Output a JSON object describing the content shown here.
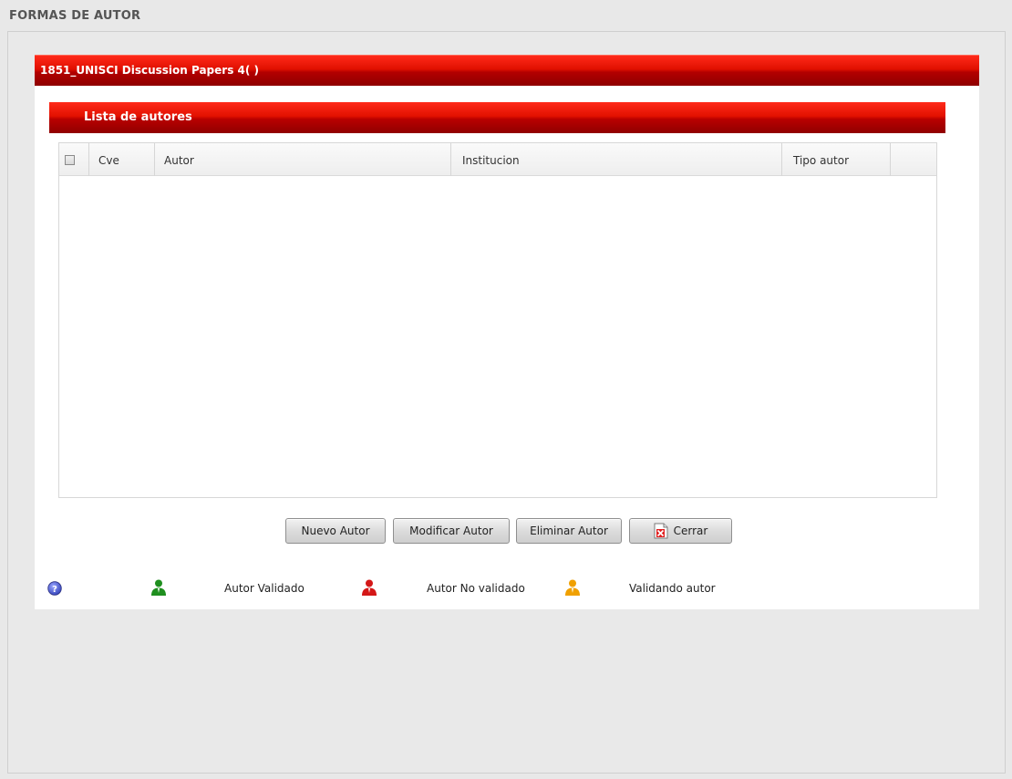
{
  "page": {
    "title": "FORMAS DE AUTOR"
  },
  "panel": {
    "header": "1851_UNISCI Discussion Papers 4( )",
    "sub_header": "Lista de autores"
  },
  "grid": {
    "columns": [
      "Cve",
      "Autor",
      "Institucion",
      "Tipo autor"
    ],
    "rows": []
  },
  "buttons": {
    "new_author": "Nuevo Autor",
    "modify_author": "Modificar Autor",
    "delete_author": "Eliminar Autor",
    "close": "Cerrar"
  },
  "legend": {
    "help_icon": "help-icon",
    "validated": {
      "label": "Autor Validado",
      "color": "#1f8f1f",
      "icon": "user-icon"
    },
    "not_validated": {
      "label": "Autor No validado",
      "color": "#d41818",
      "icon": "user-icon"
    },
    "validating": {
      "label": "Validando autor",
      "color": "#f0a000",
      "icon": "user-icon"
    }
  },
  "colors": {
    "header_red": "#cc0000",
    "background": "#e8e8e8"
  }
}
